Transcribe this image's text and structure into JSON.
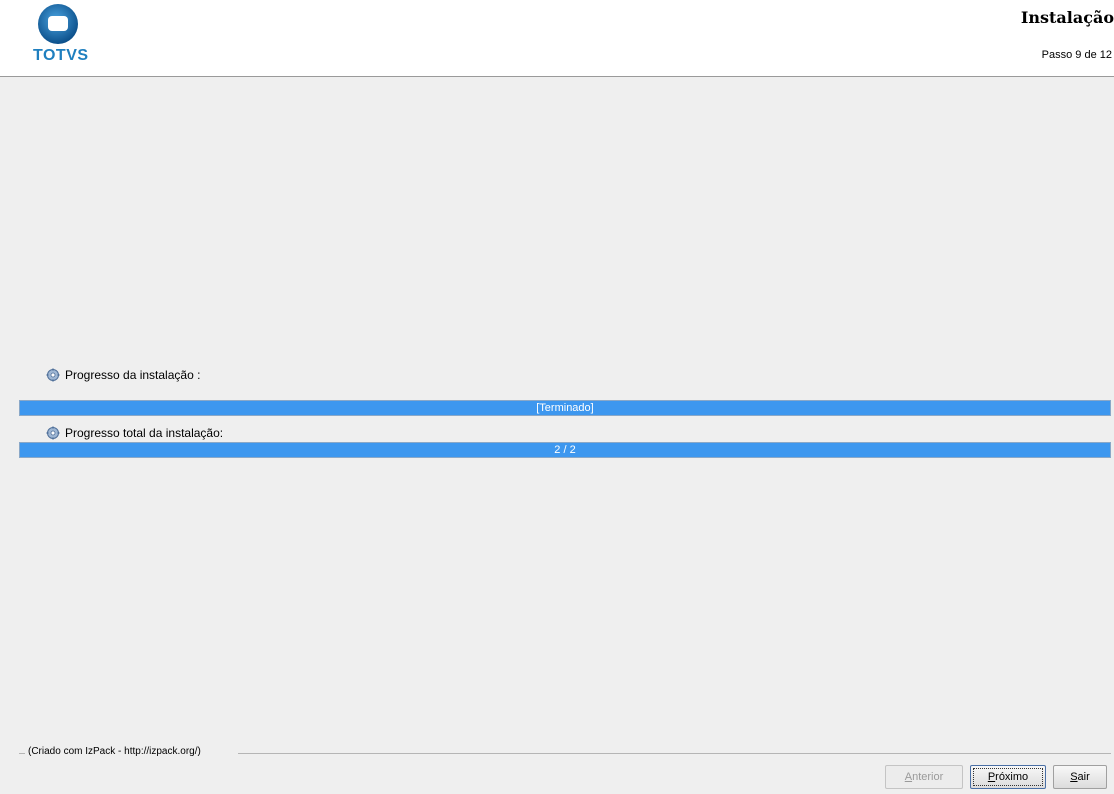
{
  "header": {
    "brand": "TOTVS",
    "title": "Instalação",
    "step_text": "Passo 9 de 12"
  },
  "progress": {
    "pack_label": "Progresso da instalação :",
    "pack_text": "[Terminado]",
    "pack_fraction": 1.0,
    "total_label": "Progresso total da instalação:",
    "total_text": "2 / 2",
    "total_fraction": 1.0
  },
  "footer": {
    "credit": "(Criado com IzPack - http://izpack.org/)",
    "buttons": {
      "previous_first": "A",
      "previous_rest": "nterior",
      "next_first": "P",
      "next_rest": "róximo",
      "quit_first": "S",
      "quit_rest": "air"
    }
  },
  "colors": {
    "progress_fill": "#3d97ef",
    "brand": "#1f7fbf"
  }
}
